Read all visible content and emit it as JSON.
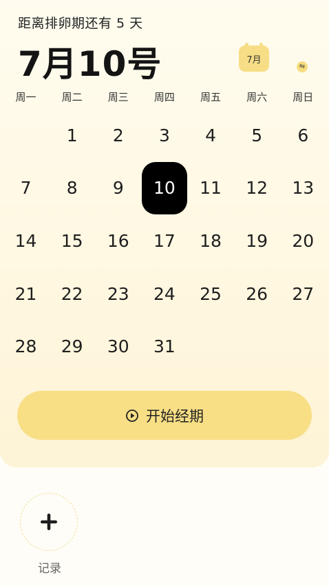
{
  "header": {
    "countdown": "距离排卵期还有 5 天",
    "date_title": "7月10号",
    "month_badge": "7月",
    "swap_icon": "⇋"
  },
  "calendar": {
    "weekdays": [
      "周一",
      "周二",
      "周三",
      "周四",
      "周五",
      "周六",
      "周日"
    ],
    "days": [
      "",
      "1",
      "2",
      "3",
      "4",
      "5",
      "6",
      "7",
      "8",
      "9",
      "10",
      "11",
      "12",
      "13",
      "14",
      "15",
      "16",
      "17",
      "18",
      "19",
      "20",
      "21",
      "22",
      "23",
      "24",
      "25",
      "26",
      "27",
      "28",
      "29",
      "30",
      "31",
      "",
      "",
      ""
    ],
    "selected_day": "10"
  },
  "actions": {
    "start_period_label": "开始经期",
    "record_label": "记录"
  },
  "colors": {
    "accent": "#f8df85",
    "selected_bg": "#000000",
    "background": "#fffcef"
  }
}
